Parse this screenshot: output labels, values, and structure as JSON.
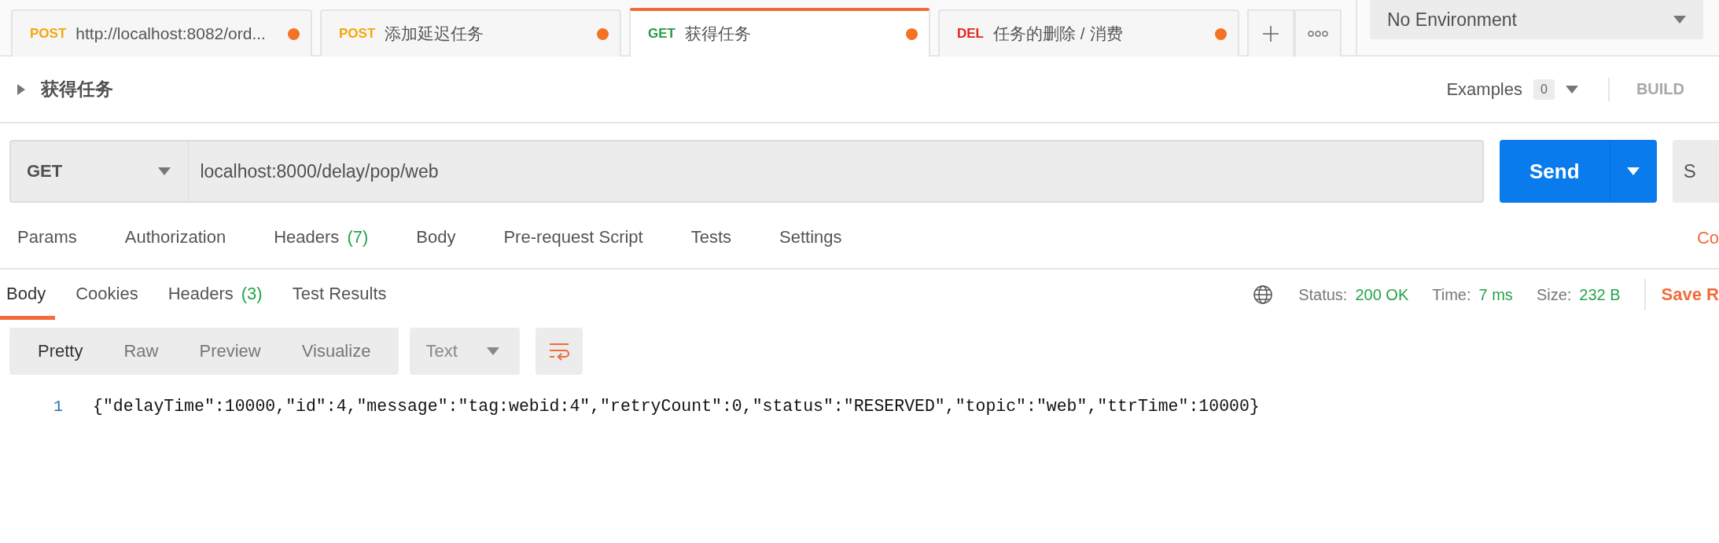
{
  "request_tabs": [
    {
      "method": {
        "text": "POST",
        "color": "#f4a60c"
      },
      "title": "http://localhost:8082/ord...",
      "unsaved": true,
      "selected": false
    },
    {
      "method": {
        "text": "POST",
        "color": "#f4a60c"
      },
      "title": "添加延迟任务",
      "unsaved": true,
      "selected": false
    },
    {
      "method": {
        "text": "GET",
        "color": "#249c47"
      },
      "title": "获得任务",
      "unsaved": true,
      "selected": true
    },
    {
      "method": {
        "text": "DEL",
        "color": "#e0261c"
      },
      "title": "任务的删除 / 消费",
      "unsaved": true,
      "selected": false
    }
  ],
  "environment": {
    "value": "No Environment"
  },
  "request": {
    "name": "获得任务",
    "examples_label": "Examples",
    "examples_count": "0",
    "build": "BUILD"
  },
  "url_bar": {
    "method": "GET",
    "url": "localhost:8000/delay/pop/web",
    "send": "Send",
    "side_button": "S"
  },
  "request_sections": [
    {
      "label": "Params",
      "selected": false
    },
    {
      "label": "Authorization",
      "selected": false
    },
    {
      "label": "Headers",
      "count": "(7)",
      "selected": false
    },
    {
      "label": "Body",
      "selected": false
    },
    {
      "label": "Pre-request Script",
      "selected": false
    },
    {
      "label": "Tests",
      "selected": false
    },
    {
      "label": "Settings",
      "selected": false
    }
  ],
  "request_sections_link": "Co",
  "response_sections": [
    {
      "label": "Body",
      "selected": true
    },
    {
      "label": "Cookies",
      "selected": false
    },
    {
      "label": "Headers",
      "count": "(3)",
      "selected": false
    },
    {
      "label": "Test Results",
      "selected": false
    }
  ],
  "response_meta": [
    {
      "label": "Status:",
      "value": "200 OK"
    },
    {
      "label": "Time:",
      "value": "7 ms"
    },
    {
      "label": "Size:",
      "value": "232 B"
    }
  ],
  "save_response": "Save R",
  "view_modes": [
    {
      "label": "Pretty",
      "selected": true
    },
    {
      "label": "Raw",
      "selected": false
    },
    {
      "label": "Preview",
      "selected": false
    },
    {
      "label": "Visualize",
      "selected": false
    }
  ],
  "format": {
    "value": "Text"
  },
  "code_lines": [
    {
      "number": "1",
      "text": "{\"delayTime\":10000,\"id\":4,\"message\":\"tag:webid:4\",\"retryCount\":0,\"status\":\"RESERVED\",\"topic\":\"web\",\"ttrTime\":10000}"
    }
  ]
}
